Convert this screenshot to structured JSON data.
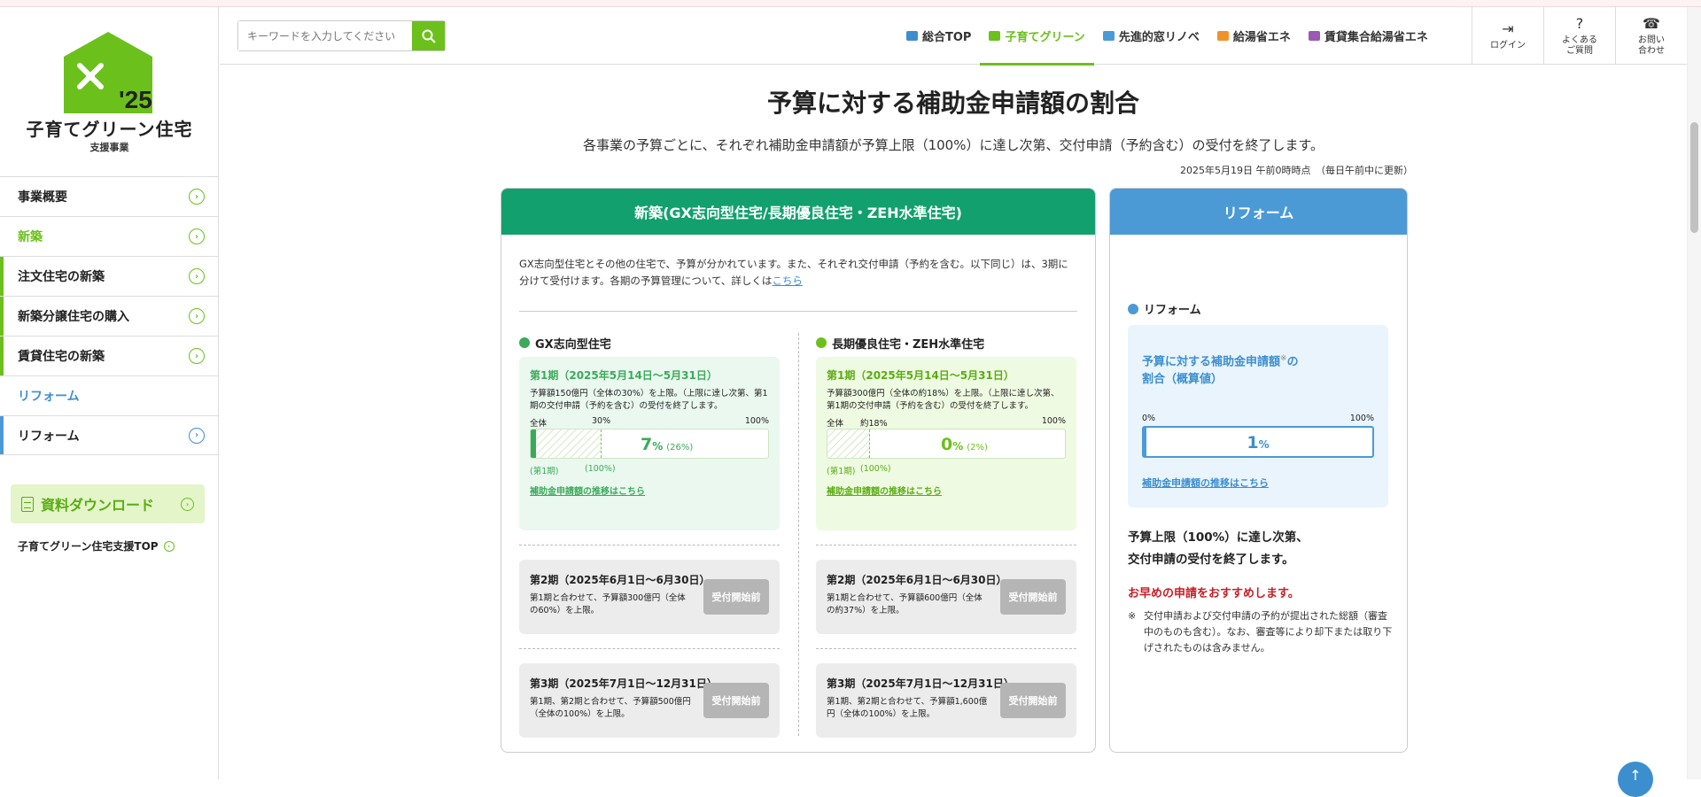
{
  "brand": {
    "logo_year": "'25",
    "title": "子育てグリーン住宅",
    "subtitle": "支援事業",
    "color_green": "#6cc01c",
    "color_teal": "#12a06e",
    "color_blue": "#4b9ad6"
  },
  "sidebar": {
    "items": [
      {
        "label": "事業概要",
        "icon": "chevron-circle-icon"
      },
      {
        "label": "新築",
        "icon": "chevron-circle-icon"
      },
      {
        "label": "注文住宅の新築",
        "icon": "chevron-circle-icon"
      },
      {
        "label": "新築分譲住宅の購入",
        "icon": "chevron-circle-icon"
      },
      {
        "label": "賃貸住宅の新築",
        "icon": "chevron-circle-icon"
      },
      {
        "label": "リフォーム"
      },
      {
        "label": "リフォーム",
        "icon": "chevron-circle-icon"
      }
    ],
    "download_label": "資料ダウンロード",
    "top_link": "子育てグリーン住宅支援TOP"
  },
  "header": {
    "search_placeholder": "キーワードを入力してください",
    "tabs": [
      {
        "label": "総合TOP",
        "active": false,
        "icon_color": "#3c8fcf"
      },
      {
        "label": "子育てグリーン",
        "active": true,
        "icon_color": "#6cc01c"
      },
      {
        "label": "先進的窓リノベ",
        "active": false,
        "icon_color": "#4b9ad6"
      },
      {
        "label": "給湯省エネ",
        "active": false,
        "icon_color": "#f0922b"
      },
      {
        "label": "賃貸集合給湯省エネ",
        "active": false,
        "icon_color": "#9b59b6"
      }
    ],
    "buttons": {
      "login": "ログイン",
      "faq_line1": "よくある",
      "faq_line2": "ご質問",
      "contact_line1": "お問い",
      "contact_line2": "合わせ"
    }
  },
  "main": {
    "title": "予算に対する補助金申請額の割合",
    "description": "各事業の予算ごとに、それぞれ補助金申請額が予算上限（100%）に達し次第、交付申請（予約含む）の受付を終了します。",
    "updated": "2025年5月19日 午前0時時点　（毎日午前中に更新）"
  },
  "new_build": {
    "header": "新築(GX志向型住宅/長期優良住宅・ZEH水準住宅)",
    "intro_text": "GX志向型住宅とその他の住宅で、予算が分かれています。また、それぞれ交付申請（予約を含む。以下同じ）は、3期に分けて受付けます。各期の予算管理について、詳しくは",
    "intro_link": "こちら",
    "gx": {
      "title": "GX志向型住宅",
      "period1_title": "第1期（2025年5月14日〜5月31日）",
      "period1_desc": "予算額150億円（全体の30%）を上限。（上限に達し次第、第1期の交付申請（予約を含む）の受付を終了します。",
      "label_all": "全体",
      "label_cap": "30%",
      "label_max": "100%",
      "cap_fraction": 0.3,
      "fill_fraction": 0.07,
      "percent": "7",
      "percent_unit": "%",
      "percent_sub": "(26%)",
      "under_left": "(第1期)",
      "under_right": "(100%)",
      "trend_link": "補助金申請額の推移はこちら",
      "period2_title": "第2期（2025年6月1日〜6月30日）",
      "period2_desc": "第1期と合わせて、予算額300億円（全体の60%）を上限。",
      "period3_title": "第3期（2025年7月1日〜12月31日）",
      "period3_desc": "第1期、第2期と合わせて、予算額500億円（全体の100%）を上限。",
      "badge": "受付開始前"
    },
    "zeh": {
      "title": "長期優良住宅・ZEH水準住宅",
      "period1_title": "第1期（2025年5月14日〜5月31日）",
      "period1_desc": "予算額300億円（全体の約18%）を上限。（上限に達し次第、第1期の交付申請（予約を含む）の受付を終了します。",
      "label_all": "全体",
      "label_cap": "約18%",
      "label_max": "100%",
      "cap_fraction": 0.18,
      "fill_fraction": 0.0,
      "percent": "0",
      "percent_unit": "%",
      "percent_sub": "(2%)",
      "under_left": "(第1期)",
      "under_right": "(100%)",
      "trend_link": "補助金申請額の推移はこちら",
      "period2_title": "第2期（2025年6月1日〜6月30日）",
      "period2_desc": "第1期と合わせて、予算額600億円（全体の約37%）を上限。",
      "period3_title": "第3期（2025年7月1日〜12月31日）",
      "period3_desc": "第1期、第2期と合わせて、予算額1,600億円（全体の100%）を上限。",
      "badge": "受付開始前"
    }
  },
  "reform": {
    "header": "リフォーム",
    "title": "リフォーム",
    "box_title_1": "予算に対する補助金申請額",
    "box_title_mark": "※",
    "box_title_2": "の",
    "box_title_3": "割合（概算値）",
    "scale_min": "0%",
    "scale_max": "100%",
    "fill_fraction": 0.01,
    "percent": "1",
    "percent_unit": "%",
    "trend_link": "補助金申請額の推移はこちら",
    "notice_1": "予算上限（100%）に達し次第、",
    "notice_2": "交付申請の受付を終了します。",
    "warning": "お早めの申請をおすすめします。",
    "note_mark": "※",
    "note": "交付申請および交付申請の予約が提出された総額（審査中のものも含む）。なお、審査等により却下または取り下げされたものは含みません。"
  }
}
